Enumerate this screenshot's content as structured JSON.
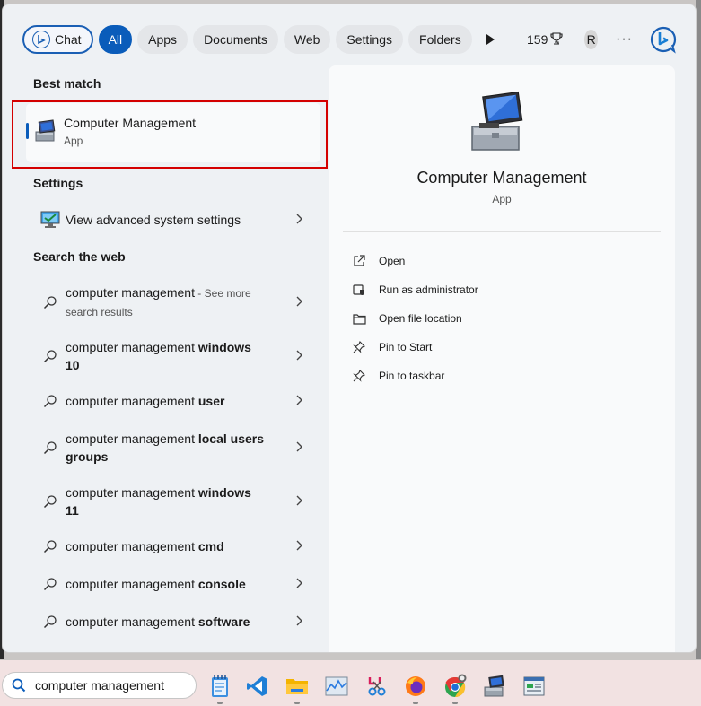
{
  "filters": {
    "chat": "Chat",
    "all": "All",
    "apps": "Apps",
    "documents": "Documents",
    "web": "Web",
    "settings": "Settings",
    "folders": "Folders",
    "points": "159",
    "avatar_initial": "R",
    "more": "···"
  },
  "best_match": {
    "header": "Best match",
    "title": "Computer Management",
    "subtitle": "App"
  },
  "settings_section": {
    "header": "Settings",
    "item": "View advanced system settings"
  },
  "web_section": {
    "header": "Search the web",
    "items": [
      {
        "prefix": "computer management",
        "bold": "",
        "suffix": " - ",
        "muted": "See more search results"
      },
      {
        "prefix": "computer management ",
        "bold": "windows 10"
      },
      {
        "prefix": "computer management ",
        "bold": "user"
      },
      {
        "prefix": "computer management ",
        "bold": "local users groups"
      },
      {
        "prefix": "computer management ",
        "bold": "windows 11"
      },
      {
        "prefix": "computer management ",
        "bold": "cmd"
      },
      {
        "prefix": "computer management ",
        "bold": "console"
      },
      {
        "prefix": "computer management ",
        "bold": "software"
      }
    ]
  },
  "detail": {
    "title": "Computer Management",
    "subtitle": "App",
    "actions": [
      "Open",
      "Run as administrator",
      "Open file location",
      "Pin to Start",
      "Pin to taskbar"
    ]
  },
  "taskbar": {
    "search_value": "computer management",
    "apps": [
      "notepad",
      "vscode",
      "file-explorer",
      "performance-monitor",
      "snipping-tool",
      "firefox",
      "chrome",
      "computer-management",
      "control-panel"
    ]
  },
  "colors": {
    "accent": "#0a5cba",
    "highlight": "#d40000"
  }
}
